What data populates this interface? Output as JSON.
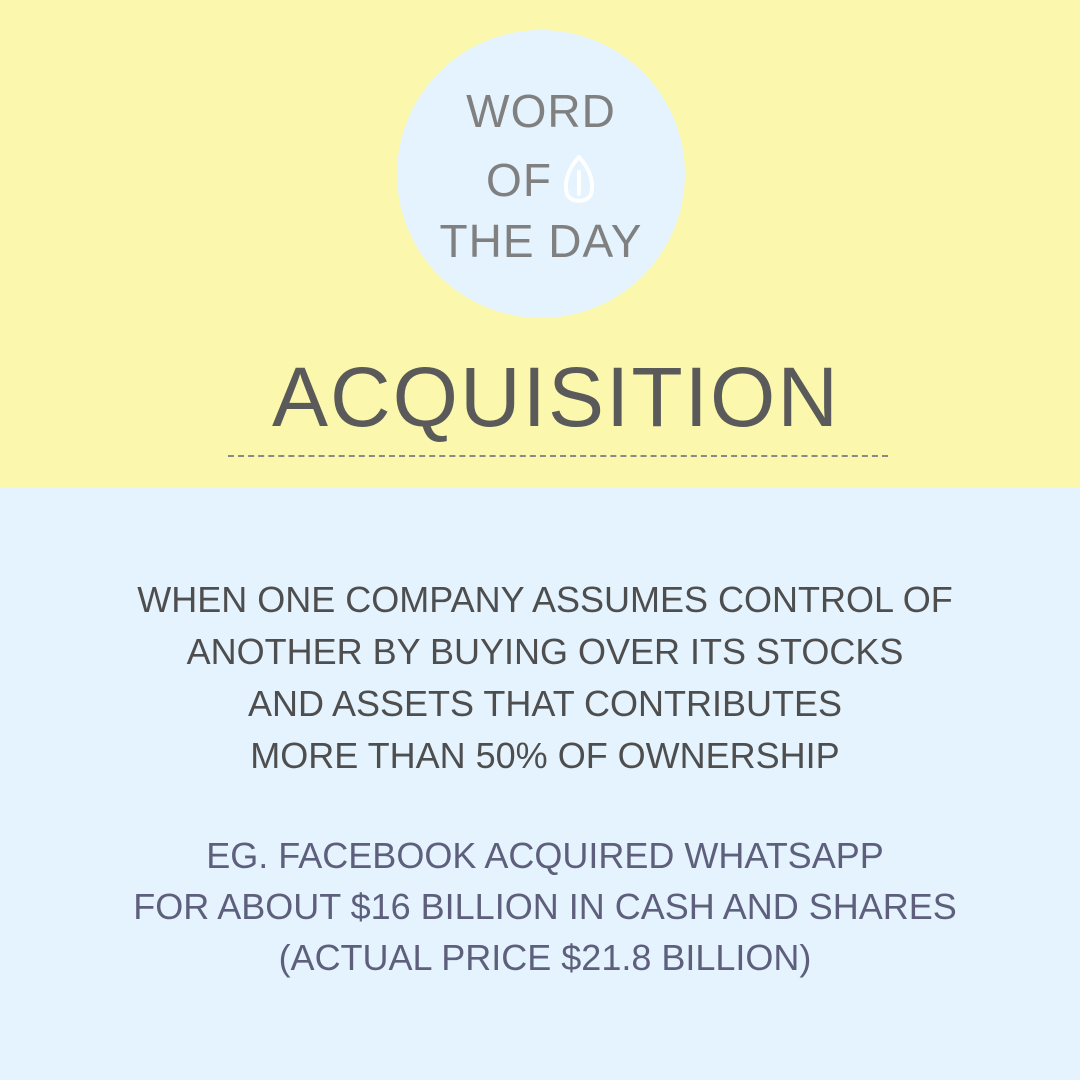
{
  "colors": {
    "top_background": "#fbf7ad",
    "bottom_background": "#e4f3fd",
    "badge_background": "#e4f3fd",
    "badge_text": "#808080",
    "title_text": "#5a5a5a",
    "definition_text": "#4e4e4e",
    "example_text": "#5e5f7c"
  },
  "badge": {
    "line1": "WORD",
    "line2": "OF",
    "line3": "THE DAY",
    "icon": "leaf-icon"
  },
  "word": {
    "title": "ACQUISITION"
  },
  "definition": {
    "lines": [
      "WHEN ONE COMPANY ASSUMES CONTROL OF",
      "ANOTHER BY BUYING OVER ITS STOCKS",
      "AND ASSETS THAT CONTRIBUTES",
      "MORE THAN 50% OF OWNERSHIP"
    ]
  },
  "example": {
    "lines": [
      "EG. FACEBOOK ACQUIRED WHATSAPP",
      "FOR ABOUT $16 BILLION IN CASH AND SHARES",
      "(ACTUAL PRICE $21.8 BILLION)"
    ]
  }
}
